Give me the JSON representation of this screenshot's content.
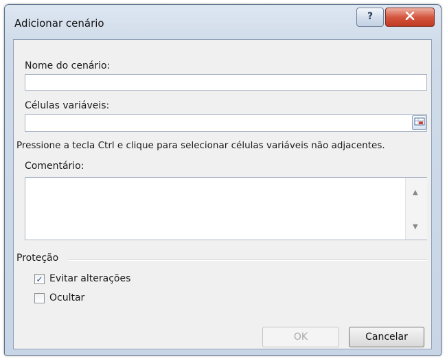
{
  "dialog": {
    "title": "Adicionar cenário",
    "scenario_name": {
      "label": "Nome do cenário:",
      "value": ""
    },
    "changing_cells": {
      "label": "Células variáveis:",
      "value": ""
    },
    "hint": "Pressione a tecla Ctrl e clique para selecionar células variáveis não adjacentes.",
    "comment": {
      "label": "Comentário:",
      "value": ""
    },
    "protection": {
      "label": "Proteção",
      "prevent_changes": {
        "label": "Evitar alterações",
        "checked": true
      },
      "hide": {
        "label": "Ocultar",
        "checked": false
      }
    },
    "buttons": {
      "ok": "OK",
      "cancel": "Cancelar"
    }
  },
  "icons": {
    "help": "help-icon",
    "close": "close-icon",
    "range_select": "range-select-icon",
    "scroll_up": "scroll-up-icon",
    "scroll_down": "scroll-down-icon",
    "check": "checkmark-icon"
  },
  "colors": {
    "title_gradient_top": "#dde6f1",
    "close_button": "#c9442c",
    "client_background": "#f0f0f0",
    "checkmark": "#2a4d8f"
  }
}
